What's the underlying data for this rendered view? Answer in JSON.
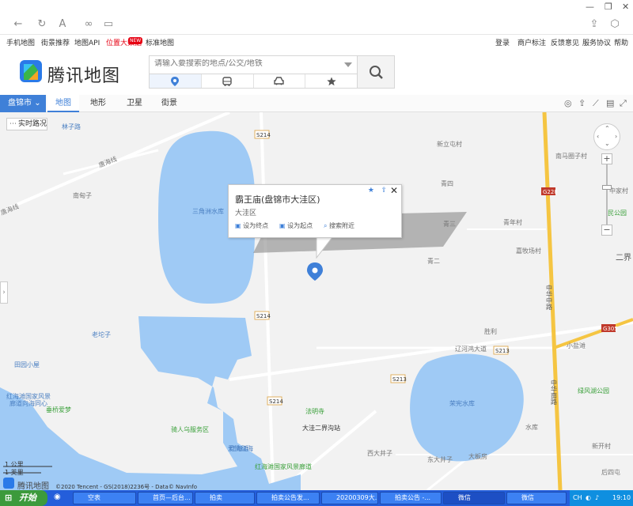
{
  "browser": {
    "tab_title": ""
  },
  "links_left": [
    "手机地图",
    "街景推荐",
    "地图API",
    "位置大数据",
    "标准地图"
  ],
  "links_right": [
    "登录",
    "商户标注",
    "反馈意见",
    "服务协议",
    "帮助"
  ],
  "hot_badge": "NEW",
  "logo": {
    "text": "腾讯地图"
  },
  "search": {
    "placeholder": "请输入要搜索的地点/公交/地铁"
  },
  "modes": [
    "location-pin-icon",
    "bus-icon",
    "car-icon",
    "star-icon"
  ],
  "nav": {
    "city": "盘锦市",
    "tabs": [
      "地图",
      "地形",
      "卫星",
      "街景"
    ]
  },
  "traffic_button": "实时路况",
  "popup": {
    "title": "霸王庙(盘锦市大洼区)",
    "subtitle": "大洼区",
    "actions": [
      "设为终点",
      "设为起点",
      "搜索附近"
    ]
  },
  "map_labels": {
    "road_tags": [
      "S214",
      "S214",
      "S214",
      "S213",
      "S213",
      "G228",
      "G305"
    ],
    "places": [
      "林子路",
      "唐海线",
      "唐海线",
      "南甸子",
      "三角洲水库",
      "新立屯村",
      "青四",
      "南马圈子村",
      "中家村",
      "民公园",
      "青三",
      "青年村",
      "嘉牧场村",
      "青二",
      "二界",
      "中华中路",
      "胜利",
      "辽河鸿大道",
      "小盐滩",
      "老坨子",
      "田园小屋",
      "红海滩国家风景",
      "廊道向海同心",
      "垂桥爱梦",
      "红海滩",
      "荣宪水库",
      "中华南路",
      "绿风湖公园",
      "法明寺",
      "大洼二界沟站",
      "骑人乌服务区",
      "爱情红海",
      "红海滩国家风景廊道",
      "西大井子",
      "东大井子",
      "大板房",
      "水库",
      "新开村",
      "后四屯"
    ],
    "scale": [
      "1 公里",
      "1 英里"
    ],
    "copyright": "©2020 Tencent - GS(2018)2236号 - Data© NavInfo",
    "watermark": "腾讯地图"
  },
  "taskbar": {
    "start": "开始",
    "tasks": [
      "空表",
      "首页—后台...",
      "拍卖",
      "拍卖公告发...",
      "20200309大...",
      "拍卖公告 -...",
      "微信",
      "微信"
    ],
    "clock": "19:10",
    "ime": "CH"
  }
}
